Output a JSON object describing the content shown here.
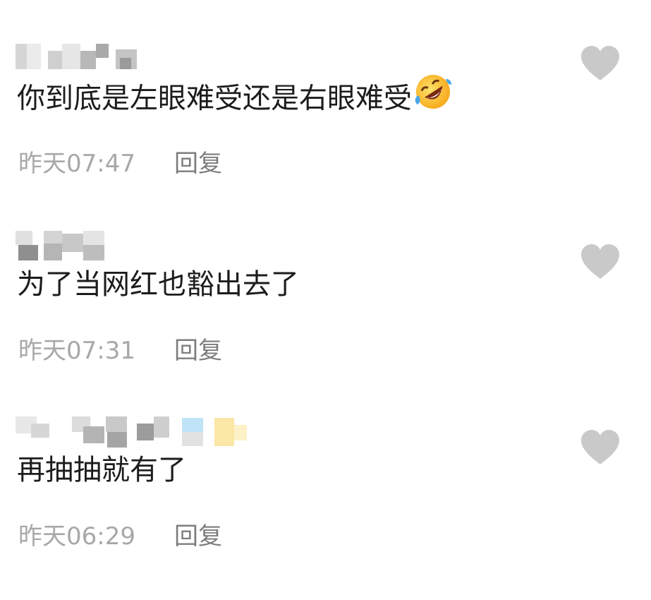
{
  "comments": [
    {
      "text": "你到底是左眼难受还是右眼难受",
      "emoji": "rolling-on-floor-laughing-emoji",
      "time": "昨天07:47",
      "reply_label": "回复"
    },
    {
      "text": "为了当网红也豁出去了",
      "time": "昨天07:31",
      "reply_label": "回复"
    },
    {
      "text": "再抽抽就有了",
      "time": "昨天06:29",
      "reply_label": "回复"
    }
  ],
  "icons": {
    "like": "heart-icon",
    "avatar_name": "pixelated-username"
  },
  "colors": {
    "text": "#1c1c1c",
    "meta": "#a8a8a8",
    "reply": "#7d7d7d",
    "heart": "#c9c9c9"
  }
}
